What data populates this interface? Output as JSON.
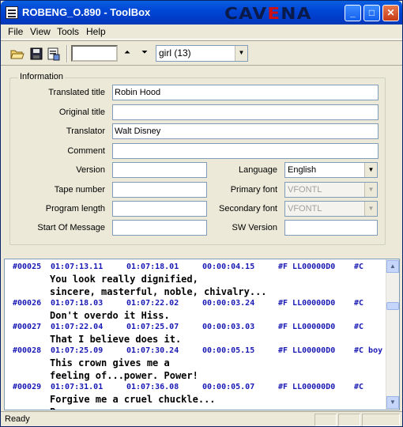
{
  "title": "ROBENG_O.890 - ToolBox",
  "logo": {
    "part1": "CAV",
    "part2": "E",
    "part3": "NA"
  },
  "window_buttons": {
    "minimize": "_",
    "maximize": "□",
    "close": "✕"
  },
  "menu": [
    "File",
    "View",
    "Tools",
    "Help"
  ],
  "toolbar": {
    "icons": [
      "open-folder-icon",
      "save-disk-icon",
      "properties-icon"
    ],
    "search_value": "",
    "up_arrow": "⏶",
    "down_arrow": "⏷",
    "speaker_selected": "girl (13)"
  },
  "info": {
    "group_title": "Information",
    "translated_title_label": "Translated title",
    "translated_title_value": "Robin Hood",
    "original_title_label": "Original title",
    "original_title_value": "",
    "translator_label": "Translator",
    "translator_value": "Walt Disney",
    "comment_label": "Comment",
    "comment_value": "",
    "version_label": "Version",
    "version_value": "",
    "tape_number_label": "Tape number",
    "tape_number_value": "",
    "program_length_label": "Program length",
    "program_length_value": "",
    "start_of_message_label": "Start Of Message",
    "start_of_message_value": "",
    "language_label": "Language",
    "language_value": "English",
    "primary_font_label": "Primary font",
    "primary_font_value": "VFONTL",
    "secondary_font_label": "Secondary font",
    "secondary_font_value": "VFONTL",
    "sw_version_label": "SW Version",
    "sw_version_value": ""
  },
  "subtitles": [
    {
      "num": "#00025",
      "in": "01:07:13.11",
      "out": "01:07:18.01",
      "dur": "00:00:04.15",
      "font": "#F LL00000D0",
      "col": "#C",
      "lines": [
        "You look really dignified,",
        "sincere, masterful, noble, chivalry..."
      ]
    },
    {
      "num": "#00026",
      "in": "01:07:18.03",
      "out": "01:07:22.02",
      "dur": "00:00:03.24",
      "font": "#F LL00000D0",
      "col": "#C",
      "lines": [
        "Don't overdo it Hiss."
      ]
    },
    {
      "num": "#00027",
      "in": "01:07:22.04",
      "out": "01:07:25.07",
      "dur": "00:00:03.03",
      "font": "#F LL00000D0",
      "col": "#C",
      "lines": [
        "That I believe does it."
      ]
    },
    {
      "num": "#00028",
      "in": "01:07:25.09",
      "out": "01:07:30.24",
      "dur": "00:00:05.15",
      "font": "#F LL00000D0",
      "col": "#C boy",
      "lines": [
        "This crown gives me a",
        "feeling of...power. Power!"
      ]
    },
    {
      "num": "#00029",
      "in": "01:07:31.01",
      "out": "01:07:36.08",
      "dur": "00:00:05.07",
      "font": "#F LL00000D0",
      "col": "#C",
      "lines": [
        "Forgive me a cruel chuckle...",
        "Power..."
      ]
    }
  ],
  "status": "Ready"
}
